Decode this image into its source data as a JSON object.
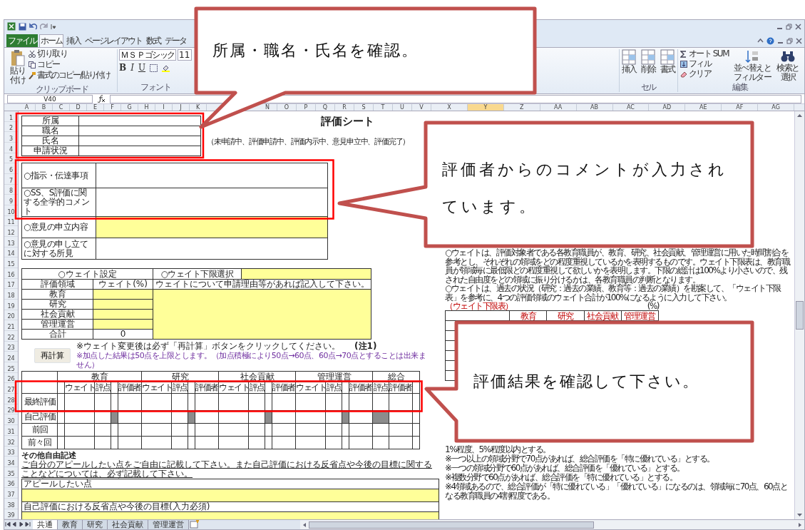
{
  "ribbon": {
    "tabs": [
      {
        "label": "ファイル",
        "kind": "file",
        "selected": false
      },
      {
        "label": "ホーム",
        "kind": "tab",
        "selected": true
      },
      {
        "label": "挿入",
        "kind": "tab",
        "selected": false
      },
      {
        "label": "ページレイアウト",
        "kind": "tab",
        "selected": false
      },
      {
        "label": "数式",
        "kind": "tab",
        "selected": false
      },
      {
        "label": "データ",
        "kind": "tab",
        "selected": false
      }
    ],
    "clipboard": {
      "paste": "貼り付け",
      "cut": "切り取り",
      "copy": "コピー",
      "format_painter": "書式のコピー/貼り付け",
      "label": "クリップボード"
    },
    "font": {
      "face": "ＭＳ Ｐゴシック",
      "size": "11",
      "format_buttons": [
        "B",
        "I",
        "U"
      ],
      "label": "フォント"
    },
    "cells": {
      "buttons": [
        "挿入",
        "削除",
        "書式"
      ],
      "label": "セル"
    },
    "editing": {
      "autosum": "オート SUM",
      "fill": "フィル",
      "clear": "クリア",
      "sort": "並べ替えとフィルター",
      "find": "検索と選択",
      "label": "編集"
    }
  },
  "formula_bar": {
    "name_box": "V40"
  },
  "column_headers": [
    {
      "label": "A",
      "selected": false
    },
    {
      "label": "B",
      "selected": false
    },
    {
      "label": "C",
      "selected": false
    },
    {
      "label": "D",
      "selected": false
    },
    {
      "label": "E",
      "selected": false
    },
    {
      "label": "F",
      "selected": false
    },
    {
      "label": "G",
      "selected": false
    },
    {
      "label": "H",
      "selected": false
    },
    {
      "label": "I",
      "selected": false
    },
    {
      "label": "J",
      "selected": false
    },
    {
      "label": "K",
      "selected": false
    },
    {
      "label": "N",
      "selected": false
    },
    {
      "label": "O",
      "selected": false
    },
    {
      "label": "P",
      "selected": false
    },
    {
      "label": "Q",
      "selected": false
    },
    {
      "label": "R",
      "selected": false
    },
    {
      "label": "S",
      "selected": false
    },
    {
      "label": "T",
      "selected": false
    },
    {
      "label": "U",
      "selected": false
    },
    {
      "label": "V",
      "selected": false
    },
    {
      "label": "X",
      "selected": false
    },
    {
      "label": "Y",
      "selected": true
    },
    {
      "label": "Z",
      "selected": false
    },
    {
      "label": "AA",
      "selected": false
    },
    {
      "label": "AB",
      "selected": false
    },
    {
      "label": "AC",
      "selected": false
    },
    {
      "label": "AD",
      "selected": false
    },
    {
      "label": "AE",
      "selected": false
    },
    {
      "label": "AF",
      "selected": false
    },
    {
      "label": "AG",
      "selected": false
    }
  ],
  "row_headers": [
    "1",
    "2",
    "3",
    "4",
    "5",
    "6",
    "7",
    "8",
    "9",
    "10",
    "11",
    "12",
    "13",
    "14",
    "15",
    "16",
    "17",
    "18",
    "19",
    "20",
    "21",
    "22",
    "23",
    "24",
    "25",
    "26",
    "27",
    "28",
    "29",
    "30",
    "31",
    "32",
    "33",
    "34",
    "35",
    "36",
    "37",
    "38",
    "39"
  ],
  "sheet": {
    "info_labels": [
      "所属",
      "職名",
      "氏名",
      "申請状況"
    ],
    "title": "評価シート",
    "status_note": "（未申請中、評価申請中、評価内示中、意見申立中、評価完了）",
    "comment_rows": [
      {
        "label": "○指示・伝達事項",
        "highlighted": false
      },
      {
        "label": "○SS、S評価に関する全学的コメント",
        "highlighted": false
      },
      {
        "label": "○意見の申立内容",
        "highlighted": true
      },
      {
        "label": "○意見の申し立てに対する所見",
        "highlighted": false
      }
    ],
    "weight": {
      "setting": "○ウェイト設定",
      "lower_limit": "○ウェイト下限選択",
      "columns": [
        "評価領域",
        "ウェイト(%)",
        "ウェイトについて申請理由等があれば記入して下さい。"
      ],
      "rows": [
        {
          "label": "教育"
        },
        {
          "label": "研究"
        },
        {
          "label": "社会貢献"
        },
        {
          "label": "管理運営"
        },
        {
          "label": "合計",
          "value": "0"
        }
      ]
    },
    "recalc_button": "再計算",
    "recalc_note": "※ウェイト変更後は必ず「再計算」ボタンをクリックしてください。",
    "note_mark": "(注1)",
    "cap_note": "※加点した結果は50点を上限とします。（加点積極により50点→60点、60点→70点とすることは出来ません）",
    "evaluation": {
      "groups": [
        {
          "label": "教育",
          "subs": [
            {
              "self_shaded": false
            },
            {
              "label": "ウェイト",
              "self_shaded": false
            },
            {
              "label": "評点",
              "self_shaded": false
            },
            {
              "self_shaded": true
            },
            {
              "label": "評価者",
              "self_shaded": false
            }
          ]
        },
        {
          "label": "研究",
          "subs": [
            {
              "label": "ウェイト",
              "self_shaded": false
            },
            {
              "label": "評点",
              "self_shaded": false
            },
            {
              "self_shaded": true
            },
            {
              "label": "評価者",
              "self_shaded": false
            }
          ]
        },
        {
          "label": "社会貢献",
          "subs": [
            {
              "label": "ウェイト",
              "self_shaded": false
            },
            {
              "label": "評点",
              "self_shaded": false
            },
            {
              "self_shaded": true
            },
            {
              "label": "評価者",
              "self_shaded": false
            }
          ]
        },
        {
          "label": "管理運営",
          "subs": [
            {
              "label": "ウェイト",
              "self_shaded": false
            },
            {
              "label": "評点",
              "self_shaded": false
            },
            {
              "self_shaded": true
            },
            {
              "label": "評価者",
              "self_shaded": false
            }
          ]
        },
        {
          "label": "総合",
          "subs": [
            {
              "label": "評点",
              "self_shaded": true
            },
            {
              "label": "評価者",
              "self_shaded": false
            },
            {
              "self_shaded": false
            }
          ]
        }
      ],
      "rows": [
        {
          "label": "最終評価",
          "kind": "final"
        },
        {
          "label": "自己評価",
          "kind": "self"
        },
        {
          "label": "前回",
          "kind": "past"
        },
        {
          "label": "前々回",
          "kind": "past"
        }
      ]
    },
    "free_text": {
      "title": "その他自由記述",
      "instruction": "ご自分のアピールしたい点をご自由に記載して下さい。また自己評価における反省点や今後の目標に関することなどについては、必ず記載して下さい。",
      "fields": [
        "アピールしたい点",
        "自己評価における反省点や今後の目標(入力必須)"
      ]
    },
    "guidance": [
      "○ウェイトは、評価対象者である各教育職員が、教育、研究、社会貢献、管理運営に用いた時間割合を参考とし、それぞれの領域をどの程度重視しているかを表明するものです。ウェイト下限表は、教育職員が領域毎に最低限どの程度重視して欲しいかを表明します。下限の総計は100%より小さいので、残された自由度をどの領域に振り分けるかは、各教育職員の判断となります。",
      "○ウェイトは、過去の状況（研究：過去の業績、教育等：過去の業績）を勘案して、「ウェイト下限表」を参考に、4つの評価領域のウェイト合計が100%になるように入力して下さい。"
    ],
    "lower_table": {
      "title": "（ウェイト下限表）",
      "unit": "(%)",
      "columns": [
        "教育",
        "研究",
        "社会貢献",
        "管理運営"
      ]
    },
    "notes": [
      "1%程度、5%程度以内とする。",
      "※一つ以上の領域分野で70点があれば、総合評価を「特に優れている」とする。",
      "※一つの領域分野で60点があれば、総合評価を「優れている」とする。",
      "※複数分野で60点があれば、総合評価を「特に優れている」とする。",
      "※4領域あるので、総合評価が「特に優れている」「優れている」になるのは、領域毎に70点、60点と",
      "なる教育職員の4割程度である。"
    ]
  },
  "sheet_tabs": [
    {
      "label": "共通",
      "selected": true
    },
    {
      "label": "教育",
      "selected": false
    },
    {
      "label": "研究",
      "selected": false
    },
    {
      "label": "社会貢献",
      "selected": false
    },
    {
      "label": "管理運営",
      "selected": false
    }
  ],
  "callouts": [
    "所属・職名・氏名を確認。",
    "評価者からのコメントが入力されています。",
    "評価結果を確認して下さい。"
  ]
}
